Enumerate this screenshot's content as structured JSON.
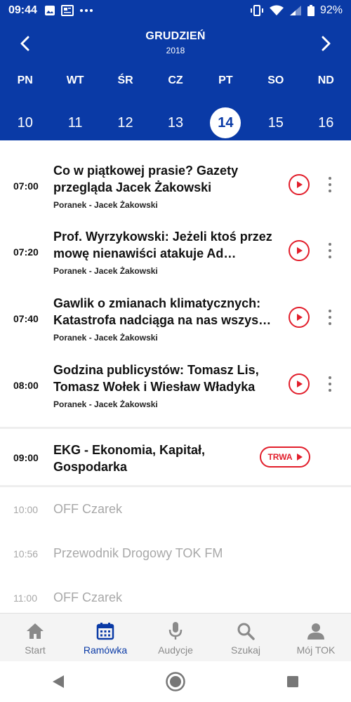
{
  "status_bar": {
    "time": "09:44",
    "battery": "92%"
  },
  "calendar": {
    "month": "GRUDZIEŃ",
    "year": "2018",
    "days": [
      {
        "name": "PN",
        "num": "10"
      },
      {
        "name": "WT",
        "num": "11"
      },
      {
        "name": "ŚR",
        "num": "12"
      },
      {
        "name": "CZ",
        "num": "13"
      },
      {
        "name": "PT",
        "num": "14"
      },
      {
        "name": "SO",
        "num": "15"
      },
      {
        "name": "ND",
        "num": "16"
      }
    ],
    "selected_day": "14"
  },
  "episodes": [
    {
      "time": "07:00",
      "title": "Co w piątkowej prasie? Gazety przegląda Jacek Żakowski",
      "subtitle": "Poranek - Jacek Żakowski"
    },
    {
      "time": "07:20",
      "title": "Prof. Wyrzykowski: Jeżeli ktoś przez mowę nienawiści atakuje Ad…",
      "subtitle": "Poranek - Jacek Żakowski"
    },
    {
      "time": "07:40",
      "title": "Gawlik o zmianach klimatycznych: Katastrofa nadciąga na nas wszys…",
      "subtitle": "Poranek - Jacek Żakowski"
    },
    {
      "time": "08:00",
      "title": "Godzina publicystów: Tomasz Lis, Tomasz Wołek i Wiesław Władyka",
      "subtitle": "Poranek - Jacek Żakowski"
    }
  ],
  "live": {
    "time": "09:00",
    "title": "EKG - Ekonomia, Kapitał, Gospodarka",
    "badge": "TRWA"
  },
  "upcoming": [
    {
      "time": "10:00",
      "title": "OFF Czarek"
    },
    {
      "time": "10:56",
      "title": "Przewodnik Drogowy TOK FM"
    },
    {
      "time": "11:00",
      "title": "OFF Czarek"
    }
  ],
  "bottom_nav": [
    {
      "label": "Start",
      "icon": "home-icon"
    },
    {
      "label": "Ramówka",
      "icon": "calendar-icon",
      "active": true
    },
    {
      "label": "Audycje",
      "icon": "microphone-icon"
    },
    {
      "label": "Szukaj",
      "icon": "search-icon"
    },
    {
      "label": "Mój TOK",
      "icon": "user-icon"
    }
  ],
  "colors": {
    "primary": "#0a3aa6",
    "accent": "#e21e2b",
    "muted": "#a8a8a8"
  }
}
